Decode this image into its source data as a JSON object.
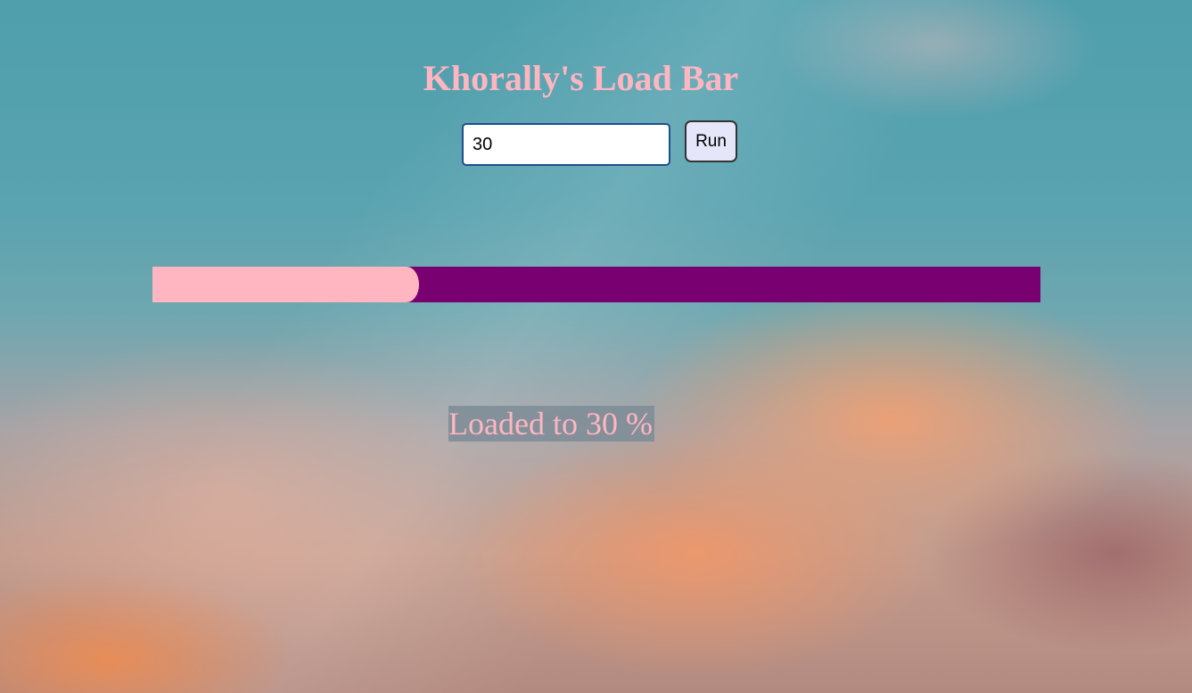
{
  "page": {
    "title": "Khorally's Load Bar"
  },
  "controls": {
    "input_value": "30",
    "run_label": "Run"
  },
  "progress": {
    "percent": 30,
    "fill_color": "#ffb6c1",
    "track_color": "#780070"
  },
  "status": {
    "text": "Loaded to 30 %"
  },
  "colors": {
    "title": "#ffb6c1",
    "button_background": "#e6e6fa"
  }
}
